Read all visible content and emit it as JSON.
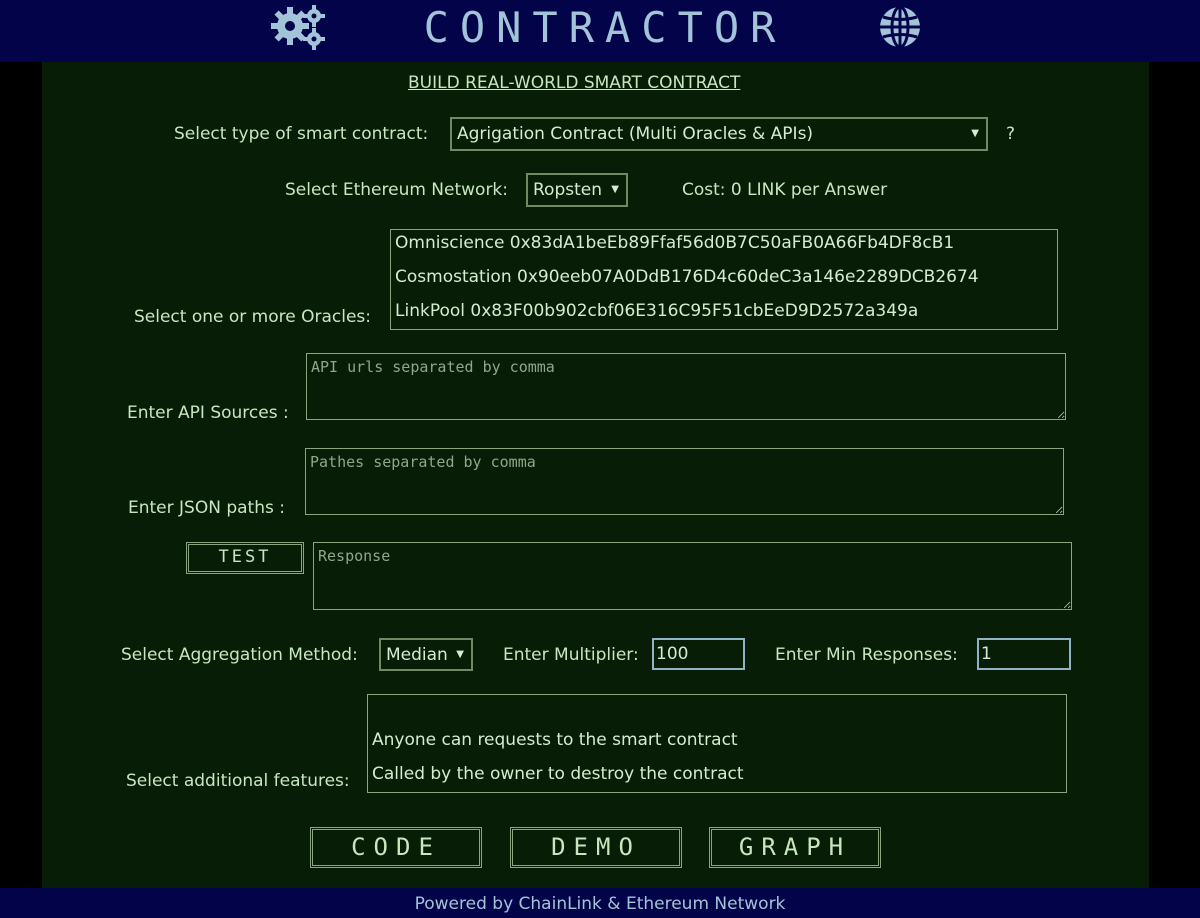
{
  "header": {
    "title": "CONTRACTOR",
    "left_icon": "gears-icon",
    "right_icon": "globe-icon"
  },
  "page": {
    "heading": "BUILD REAL-WORLD SMART CONTRACT"
  },
  "contract_type": {
    "label": "Select type of smart contract:",
    "selected": "Agrigation Contract (Multi Oracles & APIs)",
    "help": "?"
  },
  "network": {
    "label": "Select Ethereum Network:",
    "selected": "Ropsten",
    "cost": "Cost: 0 LINK per Answer"
  },
  "oracles": {
    "label": "Select one or more Oracles:",
    "items": [
      "Omniscience 0x83dA1beEb89Ffaf56d0B7C50aFB0A66Fb4DF8cB1",
      "Cosmostation 0x90eeb07A0DdB176D4c60deC3a146e2289DCB2674",
      "LinkPool 0x83F00b902cbf06E316C95F51cbEeD9D2572a349a"
    ]
  },
  "api_sources": {
    "label": "Enter API Sources :",
    "placeholder": "API urls separated by comma"
  },
  "json_paths": {
    "label": "Enter JSON paths :",
    "placeholder": "Pathes separated by comma"
  },
  "test": {
    "button_label": "TEST",
    "response_placeholder": "Response"
  },
  "aggregation": {
    "label": "Select Aggregation Method:",
    "selected": "Median",
    "multiplier_label": "Enter Multiplier:",
    "multiplier_value": "100",
    "min_responses_label": "Enter Min Responses:",
    "min_responses_value": "1"
  },
  "features": {
    "label": "Select additional features:",
    "items": [
      "Anyone can requests to the smart contract",
      "Called by the owner to destroy the contract"
    ]
  },
  "actions": {
    "code_label": "CODE",
    "demo_label": "DEMO",
    "graph_label": "GRAPH"
  },
  "footer": {
    "text": "Powered by ChainLink & Ethereum Network"
  },
  "colors": {
    "header_bg": "#03034a",
    "panel_bg": "#071d06",
    "text": "#c8e6c0",
    "title": "#a3c4d8"
  }
}
